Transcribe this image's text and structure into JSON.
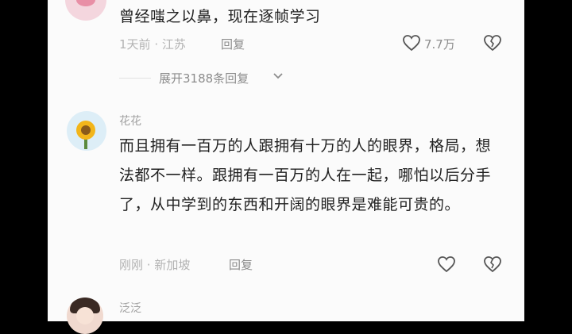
{
  "comments": [
    {
      "text": "曾经嗤之以鼻，现在逐帧学习",
      "time": "1天前",
      "location": "江苏",
      "reply_label": "回复",
      "likes": "7.7万",
      "expand_replies": "展开3188条回复"
    },
    {
      "username": "花花",
      "text": "而且拥有一百万的人跟拥有十万的人的眼界，格局，想法都不一样。跟拥有一百万的人在一起，哪怕以后分手了，从中学到的东西和开阔的眼界是难能可贵的。",
      "time": "刚刚",
      "location": "新加坡",
      "reply_label": "回复"
    },
    {
      "username": "泛泛"
    }
  ],
  "colors": {
    "background": "#fbfbfb",
    "text": "#222222",
    "meta": "#b3b3b3",
    "reply": "#8c8c8c"
  },
  "icons": [
    "heart-outline-icon",
    "broken-heart-icon",
    "chevron-down-icon"
  ]
}
